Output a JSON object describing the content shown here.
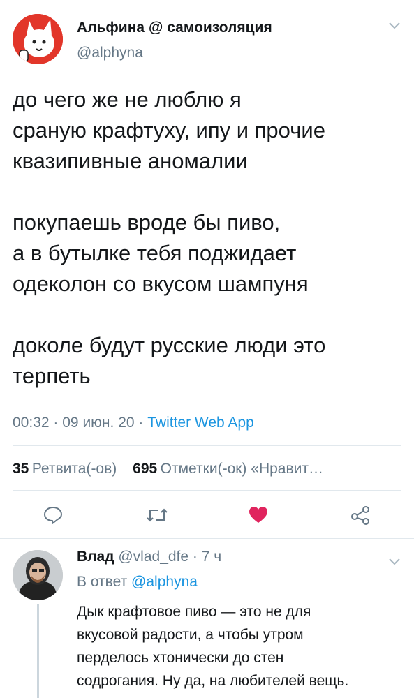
{
  "tweet": {
    "author_name": "Альфина @ самоизоляция",
    "author_handle": "@alphyna",
    "text": "до чего же не люблю я\nсраную крафтуху, ипу и прочие\nквазипивные аномалии\n\nпокупаешь вроде бы пиво,\nа в бутылке тебя поджидает\nодеколон со вкусом шампуня\n\nдоколе будут русские люди это\nтерпеть",
    "time": "00:32",
    "date": "09 июн. 20",
    "sep": "·",
    "client": "Twitter Web App",
    "retweets_count": "35",
    "retweets_label": "Ретвита(-ов)",
    "likes_count": "695",
    "likes_label": "Отметки(-ок) «Нравит…"
  },
  "actions": {
    "reply_icon": "speech-bubble-icon",
    "retweet_icon": "retweet-icon",
    "like_icon": "heart-filled-icon",
    "share_icon": "share-icon",
    "like_color": "#e0245e"
  },
  "reply": {
    "author_name": "Влад",
    "author_handle": "@vlad_dfe",
    "sep": "·",
    "time": "7 ч",
    "in_reply_prefix": "В ответ",
    "in_reply_handle": "@alphyna",
    "text": "Дык крафтовое пиво — это не для\nвкусовой радости, а чтобы утром\nперделось хтонически до стен\nсодрогания. Ну да, на любителей вещь."
  },
  "colors": {
    "accent": "#1b95e0",
    "secondary_text": "#657786",
    "divider": "#e1e8ed"
  }
}
